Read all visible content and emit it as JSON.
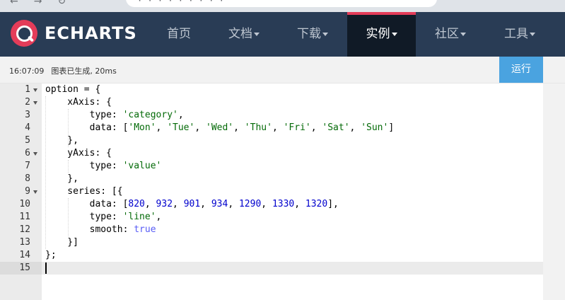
{
  "browser": {
    "nav_glyphs": "←→↻",
    "address_fragment": "· · · · · · · · ·"
  },
  "navbar": {
    "logo_text": "ECHARTS",
    "items": [
      {
        "label": "首页",
        "dropdown": false
      },
      {
        "label": "文档",
        "dropdown": true
      },
      {
        "label": "下载",
        "dropdown": true
      },
      {
        "label": "实例",
        "dropdown": true,
        "active": true
      },
      {
        "label": "社区",
        "dropdown": true
      },
      {
        "label": "工具",
        "dropdown": true
      }
    ],
    "colors": {
      "bg": "#293c55",
      "active_bg": "#101a26",
      "accent": "#e43c59"
    }
  },
  "toolbar": {
    "time": "16:07:09",
    "status": "图表已生成, 20ms",
    "run_label": "运行",
    "run_color": "#4aa3e0"
  },
  "editor": {
    "line_numbers": [
      "1",
      "2",
      "3",
      "4",
      "5",
      "6",
      "7",
      "8",
      "9",
      "10",
      "11",
      "12",
      "13",
      "14",
      "15"
    ],
    "fold_lines": [
      1,
      2,
      6,
      9
    ],
    "active_line": 15,
    "lines": [
      [
        {
          "t": "option = {",
          "c": "plain"
        }
      ],
      [
        {
          "t": "    xAxis: {",
          "c": "plain"
        }
      ],
      [
        {
          "t": "        type: ",
          "c": "plain"
        },
        {
          "t": "'category'",
          "c": "str"
        },
        {
          "t": ",",
          "c": "plain"
        }
      ],
      [
        {
          "t": "        data: [",
          "c": "plain"
        },
        {
          "t": "'Mon'",
          "c": "str"
        },
        {
          "t": ", ",
          "c": "plain"
        },
        {
          "t": "'Tue'",
          "c": "str"
        },
        {
          "t": ", ",
          "c": "plain"
        },
        {
          "t": "'Wed'",
          "c": "str"
        },
        {
          "t": ", ",
          "c": "plain"
        },
        {
          "t": "'Thu'",
          "c": "str"
        },
        {
          "t": ", ",
          "c": "plain"
        },
        {
          "t": "'Fri'",
          "c": "str"
        },
        {
          "t": ", ",
          "c": "plain"
        },
        {
          "t": "'Sat'",
          "c": "str"
        },
        {
          "t": ", ",
          "c": "plain"
        },
        {
          "t": "'Sun'",
          "c": "str"
        },
        {
          "t": "]",
          "c": "plain"
        }
      ],
      [
        {
          "t": "    },",
          "c": "plain"
        }
      ],
      [
        {
          "t": "    yAxis: {",
          "c": "plain"
        }
      ],
      [
        {
          "t": "        type: ",
          "c": "plain"
        },
        {
          "t": "'value'",
          "c": "str"
        }
      ],
      [
        {
          "t": "    },",
          "c": "plain"
        }
      ],
      [
        {
          "t": "    series: [{",
          "c": "plain"
        }
      ],
      [
        {
          "t": "        data: [",
          "c": "plain"
        },
        {
          "t": "820",
          "c": "num"
        },
        {
          "t": ", ",
          "c": "plain"
        },
        {
          "t": "932",
          "c": "num"
        },
        {
          "t": ", ",
          "c": "plain"
        },
        {
          "t": "901",
          "c": "num"
        },
        {
          "t": ", ",
          "c": "plain"
        },
        {
          "t": "934",
          "c": "num"
        },
        {
          "t": ", ",
          "c": "plain"
        },
        {
          "t": "1290",
          "c": "num"
        },
        {
          "t": ", ",
          "c": "plain"
        },
        {
          "t": "1330",
          "c": "num"
        },
        {
          "t": ", ",
          "c": "plain"
        },
        {
          "t": "1320",
          "c": "num"
        },
        {
          "t": "],",
          "c": "plain"
        }
      ],
      [
        {
          "t": "        type: ",
          "c": "plain"
        },
        {
          "t": "'line'",
          "c": "str"
        },
        {
          "t": ",",
          "c": "plain"
        }
      ],
      [
        {
          "t": "        smooth: ",
          "c": "plain"
        },
        {
          "t": "true",
          "c": "bool"
        }
      ],
      [
        {
          "t": "    }]",
          "c": "plain"
        }
      ],
      [
        {
          "t": "};",
          "c": "plain"
        }
      ],
      [
        {
          "t": "",
          "c": "plain"
        }
      ]
    ]
  }
}
